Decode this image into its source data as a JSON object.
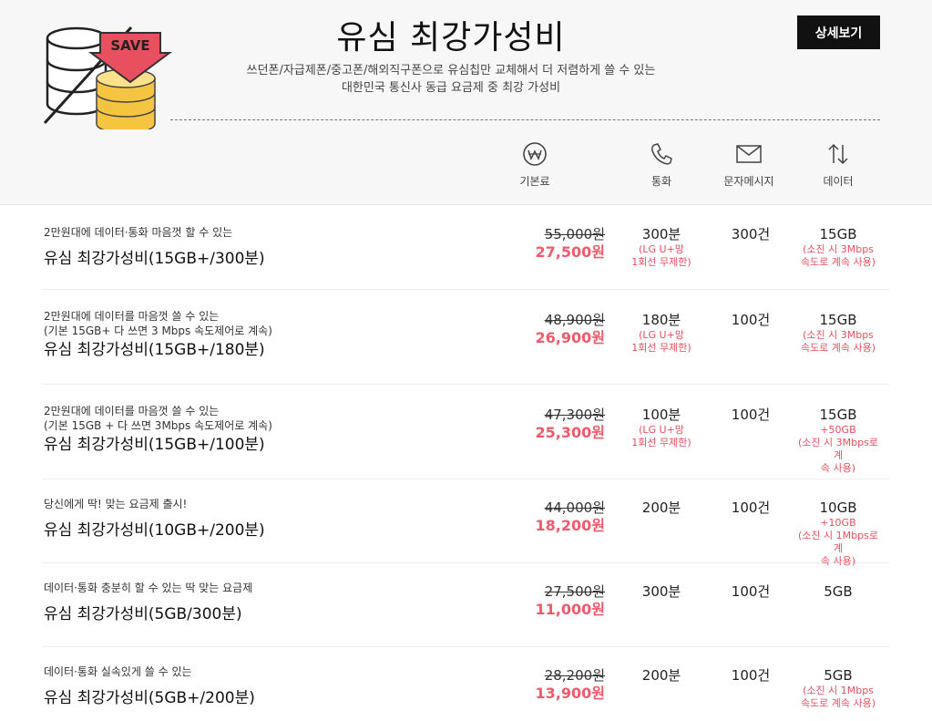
{
  "header": {
    "title": "유심 최강가성비",
    "detail_button": "상세보기",
    "subtitle_line1": "쓰던폰/자급제폰/중고폰/해외직구폰으로 유심칩만 교체해서 더 저렴하게 쓸 수 있는",
    "subtitle_line2": "대한민국 통신사 동급 요금제 중 최강 가성비",
    "logo_text": "SAVE",
    "columns": [
      {
        "label": "기본료",
        "icon": "won-icon"
      },
      {
        "label": "통화",
        "icon": "phone-icon"
      },
      {
        "label": "문자메시지",
        "icon": "envelope-icon"
      },
      {
        "label": "데이터",
        "icon": "up-down-arrows-icon"
      }
    ]
  },
  "colors": {
    "accent": "#f05a6a",
    "note": "#e8505f",
    "button": "#111111",
    "header_bg": "#f7f7f7"
  },
  "plans": [
    {
      "desc": [
        "2만원대에 데이터·통화 마음껏 할 수 있는"
      ],
      "name": "유심 최강가성비(15GB+/300분)",
      "old_price": "55,000원",
      "new_price": "27,500원",
      "call": "300분",
      "call_note": [
        "(LG U+망",
        "1회선 무제한)"
      ],
      "sms": "300건",
      "data": "15GB",
      "data_note": [
        "(소진 시 3Mbps",
        "속도로 계속 사용)"
      ]
    },
    {
      "desc": [
        "2만원대에 데이터를 마음껏 쓸 수 있는",
        "(기본 15GB+ 다 쓰면 3 Mbps 속도제어로 계속)"
      ],
      "name": "유심 최강가성비(15GB+/180분)",
      "old_price": "48,900원",
      "new_price": "26,900원",
      "call": "180분",
      "call_note": [
        "(LG U+망",
        "1회선 무제한)"
      ],
      "sms": "100건",
      "data": "15GB",
      "data_note": [
        "(소진 시 3Mbps",
        "속도로 계속 사용)"
      ]
    },
    {
      "desc": [
        "2만원대에 데이터를 마음껏 쓸 수 있는",
        "(기본 15GB + 다 쓰면 3Mbps 속도제어로 계속)"
      ],
      "name": "유심 최강가성비(15GB+/100분)",
      "old_price": "47,300원",
      "new_price": "25,300원",
      "call": "100분",
      "call_note": [
        "(LG U+망",
        "1회선 무제한)"
      ],
      "sms": "100건",
      "data": "15GB",
      "data_note": [
        "+50GB",
        "(소진 시 3Mbps로 계",
        "속 사용)"
      ]
    },
    {
      "desc": [
        "당신에게 딱! 맞는 요금제 출시!"
      ],
      "name": "유심 최강가성비(10GB+/200분)",
      "old_price": "44,000원",
      "new_price": "18,200원",
      "call": "200분",
      "call_note": [],
      "sms": "100건",
      "data": "10GB",
      "data_note": [
        "+10GB",
        "(소진 시 1Mbps로 계",
        "속 사용)"
      ]
    },
    {
      "desc": [
        "데이터·통화 충분히 할 수 있는 딱 맞는 요금제"
      ],
      "name": "유심 최강가성비(5GB/300분)",
      "old_price": "27,500원",
      "new_price": "11,000원",
      "call": "300분",
      "call_note": [],
      "sms": "100건",
      "data": "5GB",
      "data_note": []
    },
    {
      "desc": [
        "데이터·통화 실속있게 쓸 수 있는"
      ],
      "name": "유심 최강가성비(5GB+/200분)",
      "old_price": "28,200원",
      "new_price": "13,900원",
      "call": "200분",
      "call_note": [],
      "sms": "100건",
      "data": "5GB",
      "data_note": [
        "(소진 시 1Mbps",
        "속도로 계속 사용)"
      ]
    }
  ]
}
